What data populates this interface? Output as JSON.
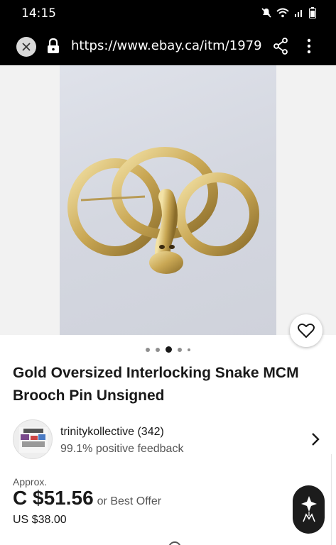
{
  "status_bar": {
    "time": "14:15"
  },
  "url_bar": {
    "url": "https://www.ebay.ca/itm/19791"
  },
  "listing": {
    "title": "Gold Oversized Interlocking Snake MCM Brooch Pin Unsigned",
    "image_count": 5,
    "active_image_index": 2
  },
  "seller": {
    "name": "trinitykollective (342)",
    "feedback": "99.1% positive feedback"
  },
  "price": {
    "approx_label": "Approx.",
    "amount": "C $51.56",
    "offer_text": "or Best Offer",
    "usd": "US $38.00"
  },
  "icons": [
    "mute-icon",
    "wifi-icon",
    "signal-icon",
    "battery-icon",
    "close-icon",
    "lock-icon",
    "share-icon",
    "more-icon",
    "heart-icon",
    "chevron-right-icon",
    "assistant-icon"
  ]
}
